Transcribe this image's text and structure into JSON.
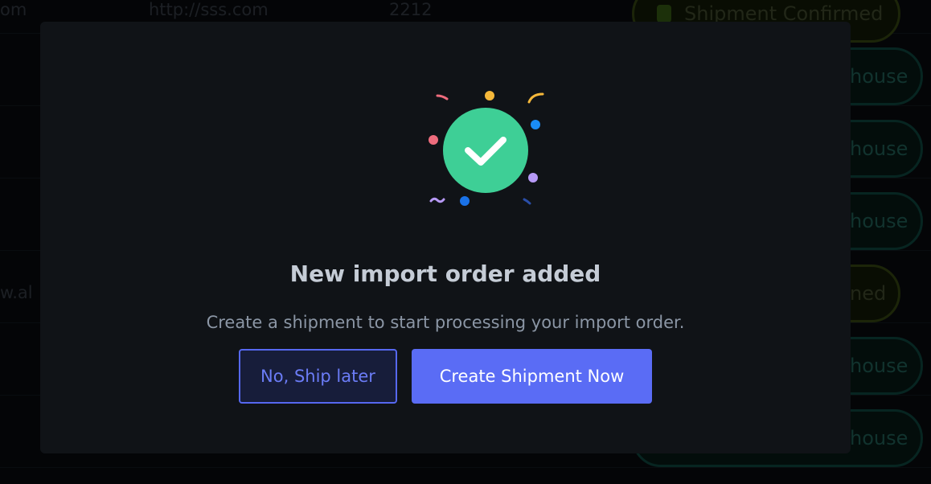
{
  "background": {
    "rows": [
      {
        "col1": "om",
        "col2": "http://sss.com",
        "col3": "2212",
        "status": "Shipment Confirmed",
        "status_kind": "confirmed"
      },
      {
        "col1": "",
        "col2": "",
        "col3": "",
        "status": "house",
        "status_kind": "warehouse"
      },
      {
        "col1": "",
        "col2": "",
        "col3": "",
        "status": "house",
        "status_kind": "warehouse"
      },
      {
        "col1": "",
        "col2": "",
        "col3": "",
        "status": "house",
        "status_kind": "warehouse"
      },
      {
        "col1": "w.al",
        "col2": "",
        "col3": "",
        "status": "ned",
        "status_kind": "confirmed"
      },
      {
        "col1": "",
        "col2": "",
        "col3": "",
        "status": "house",
        "status_kind": "warehouse"
      },
      {
        "col1": "",
        "col2": "",
        "col3": "",
        "status": "house",
        "status_kind": "warehouse"
      }
    ]
  },
  "modal": {
    "title": "New import order added",
    "subtitle": "Create a shipment to start processing your import order.",
    "secondary_button": "No, Ship later",
    "primary_button": "Create Shipment Now",
    "icon": "check-circle-icon"
  },
  "colors": {
    "accent": "#5a6cf5",
    "success": "#3ecf96",
    "modal_bg": "#101317"
  }
}
